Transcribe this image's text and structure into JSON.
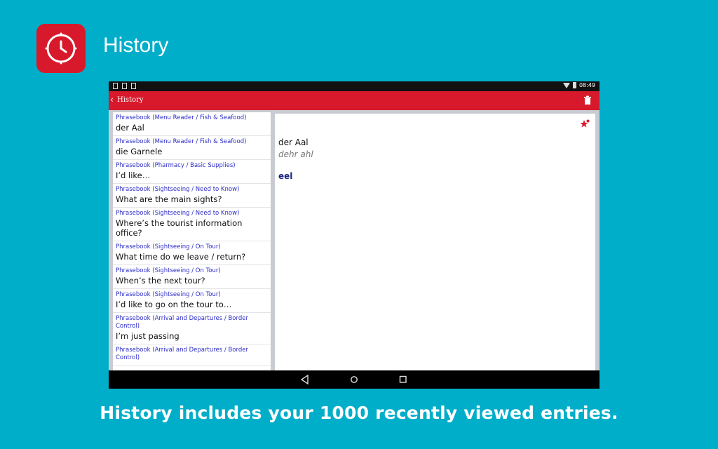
{
  "promo": {
    "title": "History",
    "caption": "History includes your 1000 recently viewed entries.",
    "icon": "clock-icon"
  },
  "status_bar": {
    "time": "08:49"
  },
  "toolbar": {
    "title": "History",
    "back_icon": "chevron-left-icon",
    "delete_icon": "trash-icon"
  },
  "history": [
    {
      "category": "Phrasebook (Menu Reader / Fish & Seafood)",
      "text": "der Aal"
    },
    {
      "category": "Phrasebook (Menu Reader / Fish & Seafood)",
      "text": "die Garnele"
    },
    {
      "category": "Phrasebook (Pharmacy / Basic Supplies)",
      "text": "I’d like…"
    },
    {
      "category": "Phrasebook (Sightseeing / Need to Know)",
      "text": "What are the main sights?"
    },
    {
      "category": "Phrasebook (Sightseeing / Need to Know)",
      "text": "Where’s the tourist information office?"
    },
    {
      "category": "Phrasebook (Sightseeing / On Tour)",
      "text": "What time do we leave / return?"
    },
    {
      "category": "Phrasebook (Sightseeing / On Tour)",
      "text": "When’s the next tour?"
    },
    {
      "category": "Phrasebook (Sightseeing / On Tour)",
      "text": "I’d like to go on the tour to…"
    },
    {
      "category": "Phrasebook (Arrival and Departures / Border Control)",
      "text": "I’m just passing"
    },
    {
      "category": "Phrasebook (Arrival and Departures / Border Control)",
      "text": ""
    }
  ],
  "detail": {
    "word": "der Aal",
    "pronunciation": "dehr ahl",
    "translation": "eel",
    "favorite_icon": "star-add-icon"
  },
  "colors": {
    "background": "#00aec9",
    "accent": "#d8192b"
  }
}
